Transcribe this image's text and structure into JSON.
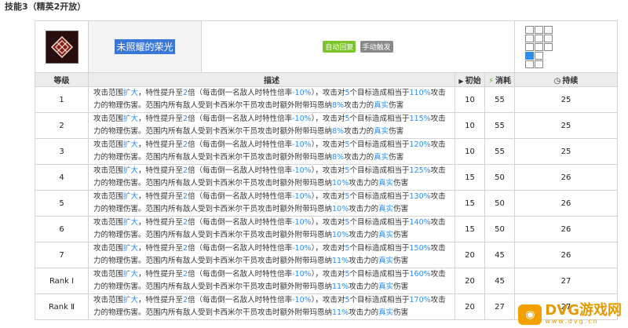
{
  "section_title": "技能3（精英2开放）",
  "skill": {
    "icon": "skill-emblem-icon",
    "name": "未照耀的荣光",
    "badges": [
      "自动回复",
      "手动触发"
    ]
  },
  "headers": {
    "level": "等级",
    "desc": "描述",
    "initial": "初始",
    "cost": "消耗",
    "duration": "持续"
  },
  "colors": {
    "highlight": "#2b8ff0",
    "badge_auto": "#7cc42a",
    "badge_manual": "#8a8a8a"
  },
  "rows": [
    {
      "level": "1",
      "pct": "110%",
      "dmg": "8%",
      "init": "10",
      "cost": "55",
      "dur": "25"
    },
    {
      "level": "2",
      "pct": "115%",
      "dmg": "8%",
      "init": "10",
      "cost": "55",
      "dur": "25"
    },
    {
      "level": "3",
      "pct": "120%",
      "dmg": "8%",
      "init": "10",
      "cost": "55",
      "dur": "25"
    },
    {
      "level": "4",
      "pct": "125%",
      "dmg": "10%",
      "init": "15",
      "cost": "50",
      "dur": "26"
    },
    {
      "level": "5",
      "pct": "130%",
      "dmg": "10%",
      "init": "15",
      "cost": "50",
      "dur": "26"
    },
    {
      "level": "6",
      "pct": "140%",
      "dmg": "10%",
      "init": "15",
      "cost": "50",
      "dur": "26"
    },
    {
      "level": "7",
      "pct": "150%",
      "dmg": "11%",
      "init": "20",
      "cost": "45",
      "dur": "26"
    },
    {
      "level": "Rank Ⅰ",
      "pct": "160%",
      "dmg": "11%",
      "init": "20",
      "cost": "45",
      "dur": "27"
    },
    {
      "level": "Rank Ⅱ",
      "pct": "170%",
      "dmg": "11%",
      "init": "20",
      "cost": "27",
      "dur": "27"
    }
  ],
  "desc_parts": {
    "p1": "攻击范围",
    "expand": "扩大",
    "p2": "，特性提升至",
    "times": "2",
    "p3": "倍（每击倒一名敌人时特性倍率",
    "rate": "-10%",
    "p4": "），攻击对",
    "targets": "5",
    "p5": "个目标造成相当于",
    "p6": "攻击力的物理伤害。范围内所有敌人受到卡西米尔干员攻击时额外附带玛恩纳",
    "p7": "攻击力的",
    "true": "真实",
    "p8": "伤害"
  },
  "watermark": {
    "main": "DVG游戏网",
    "sub": "www.dvg.cn"
  }
}
